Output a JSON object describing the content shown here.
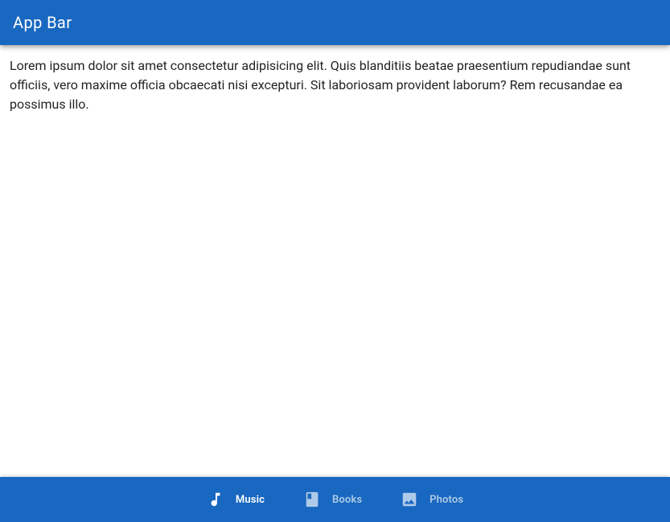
{
  "header": {
    "title": "App Bar"
  },
  "content": {
    "paragraph": "Lorem ipsum dolor sit amet consectetur adipisicing elit. Quis blanditiis beatae praesentium repudiandae sunt officiis, vero maxime officia obcaecati nisi excepturi. Sit laboriosam provident laborum? Rem recusandae ea possimus illo."
  },
  "bottomNav": {
    "items": [
      {
        "label": "Music",
        "icon": "music-note-icon",
        "active": true
      },
      {
        "label": "Books",
        "icon": "book-icon",
        "active": false
      },
      {
        "label": "Photos",
        "icon": "image-icon",
        "active": false
      }
    ]
  },
  "colors": {
    "primary": "#1867c0"
  }
}
